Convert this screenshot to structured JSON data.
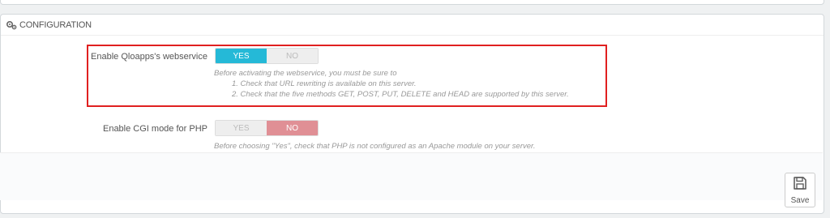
{
  "panel": {
    "title": "CONFIGURATION",
    "icon": "gears-icon"
  },
  "webservice": {
    "label": "Enable Qloapps's webservice",
    "yes": "YES",
    "no": "NO",
    "selected": "YES",
    "help_intro": "Before activating the webservice, you must be sure to",
    "help_item1": "1. Check that URL rewriting is available on this server.",
    "help_item2": "2. Check that the five methods GET, POST, PUT, DELETE and HEAD are supported by this server."
  },
  "cgi": {
    "label": "Enable CGI mode for PHP",
    "yes": "YES",
    "no": "NO",
    "selected": "NO",
    "help": "Before choosing \"Yes\", check that PHP is not configured as an Apache module on your server."
  },
  "footer": {
    "save_label": "Save",
    "save_icon": "floppy-disk-icon"
  },
  "colors": {
    "yes_active": "#25b9d7",
    "no_active": "#e08f95",
    "highlight": "#e02020"
  }
}
